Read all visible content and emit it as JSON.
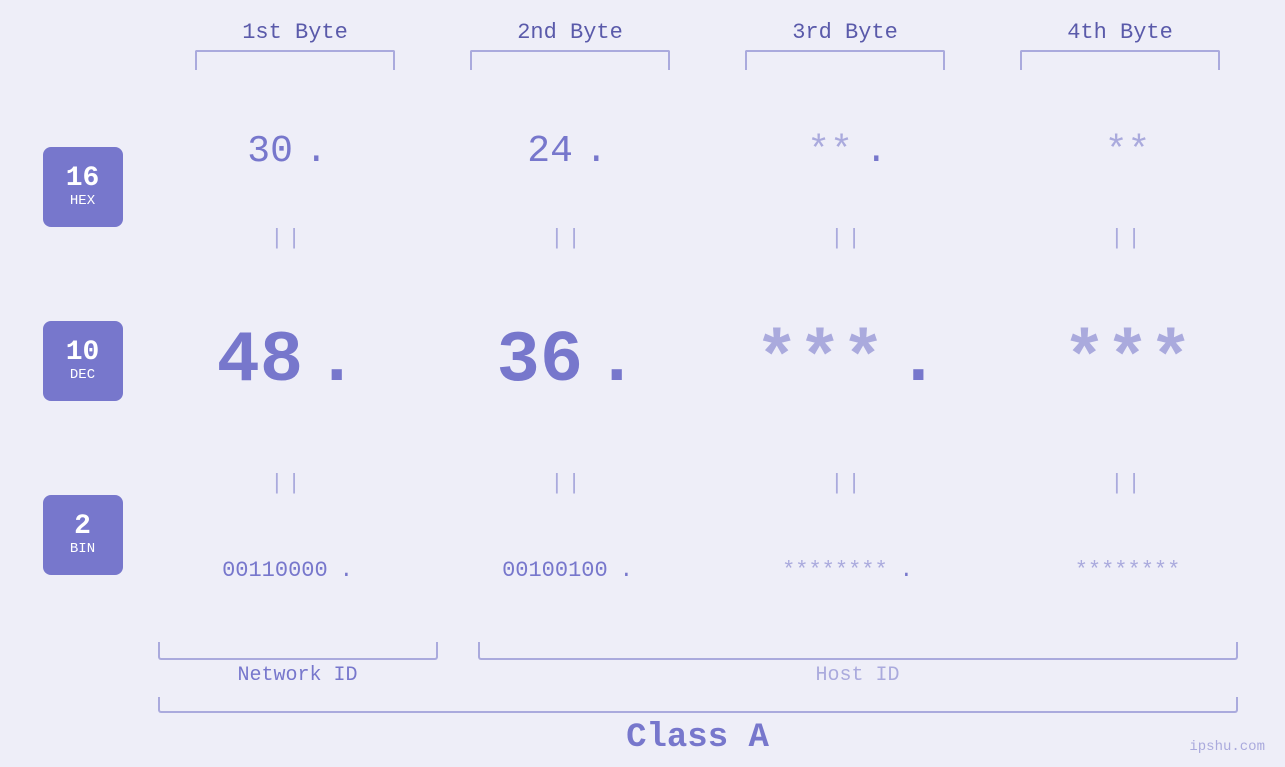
{
  "header": {
    "bytes": [
      "1st Byte",
      "2nd Byte",
      "3rd Byte",
      "4th Byte"
    ]
  },
  "badges": [
    {
      "number": "16",
      "label": "HEX"
    },
    {
      "number": "10",
      "label": "DEC"
    },
    {
      "number": "2",
      "label": "BIN"
    }
  ],
  "rows": {
    "hex": {
      "values": [
        "30",
        "24",
        "**",
        "**"
      ],
      "dots": [
        ".",
        ".",
        ".",
        ""
      ]
    },
    "dec": {
      "values": [
        "48",
        "36",
        "***",
        "***"
      ],
      "dots": [
        ".",
        ".",
        ".",
        ""
      ]
    },
    "bin": {
      "values": [
        "00110000",
        "00100100",
        "********",
        "********"
      ],
      "dots": [
        ".",
        ".",
        ".",
        ""
      ]
    }
  },
  "separator": "||",
  "labels": {
    "network_id": "Network ID",
    "host_id": "Host ID",
    "class": "Class A"
  },
  "footer": "ipshu.com"
}
